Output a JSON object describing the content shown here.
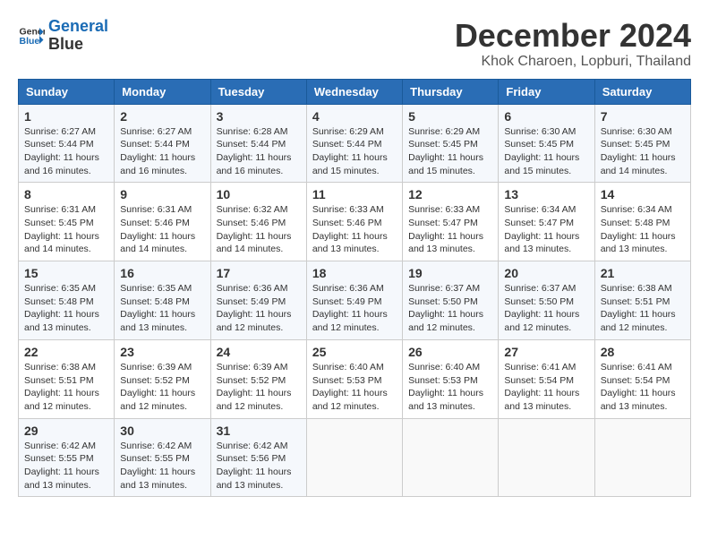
{
  "logo": {
    "line1": "General",
    "line2": "Blue"
  },
  "title": "December 2024",
  "location": "Khok Charoen, Lopburi, Thailand",
  "weekdays": [
    "Sunday",
    "Monday",
    "Tuesday",
    "Wednesday",
    "Thursday",
    "Friday",
    "Saturday"
  ],
  "weeks": [
    [
      {
        "day": 1,
        "sunrise": "6:27 AM",
        "sunset": "5:44 PM",
        "daylight": "11 hours and 16 minutes."
      },
      {
        "day": 2,
        "sunrise": "6:27 AM",
        "sunset": "5:44 PM",
        "daylight": "11 hours and 16 minutes."
      },
      {
        "day": 3,
        "sunrise": "6:28 AM",
        "sunset": "5:44 PM",
        "daylight": "11 hours and 16 minutes."
      },
      {
        "day": 4,
        "sunrise": "6:29 AM",
        "sunset": "5:44 PM",
        "daylight": "11 hours and 15 minutes."
      },
      {
        "day": 5,
        "sunrise": "6:29 AM",
        "sunset": "5:45 PM",
        "daylight": "11 hours and 15 minutes."
      },
      {
        "day": 6,
        "sunrise": "6:30 AM",
        "sunset": "5:45 PM",
        "daylight": "11 hours and 15 minutes."
      },
      {
        "day": 7,
        "sunrise": "6:30 AM",
        "sunset": "5:45 PM",
        "daylight": "11 hours and 14 minutes."
      }
    ],
    [
      {
        "day": 8,
        "sunrise": "6:31 AM",
        "sunset": "5:45 PM",
        "daylight": "11 hours and 14 minutes."
      },
      {
        "day": 9,
        "sunrise": "6:31 AM",
        "sunset": "5:46 PM",
        "daylight": "11 hours and 14 minutes."
      },
      {
        "day": 10,
        "sunrise": "6:32 AM",
        "sunset": "5:46 PM",
        "daylight": "11 hours and 14 minutes."
      },
      {
        "day": 11,
        "sunrise": "6:33 AM",
        "sunset": "5:46 PM",
        "daylight": "11 hours and 13 minutes."
      },
      {
        "day": 12,
        "sunrise": "6:33 AM",
        "sunset": "5:47 PM",
        "daylight": "11 hours and 13 minutes."
      },
      {
        "day": 13,
        "sunrise": "6:34 AM",
        "sunset": "5:47 PM",
        "daylight": "11 hours and 13 minutes."
      },
      {
        "day": 14,
        "sunrise": "6:34 AM",
        "sunset": "5:48 PM",
        "daylight": "11 hours and 13 minutes."
      }
    ],
    [
      {
        "day": 15,
        "sunrise": "6:35 AM",
        "sunset": "5:48 PM",
        "daylight": "11 hours and 13 minutes."
      },
      {
        "day": 16,
        "sunrise": "6:35 AM",
        "sunset": "5:48 PM",
        "daylight": "11 hours and 13 minutes."
      },
      {
        "day": 17,
        "sunrise": "6:36 AM",
        "sunset": "5:49 PM",
        "daylight": "11 hours and 12 minutes."
      },
      {
        "day": 18,
        "sunrise": "6:36 AM",
        "sunset": "5:49 PM",
        "daylight": "11 hours and 12 minutes."
      },
      {
        "day": 19,
        "sunrise": "6:37 AM",
        "sunset": "5:50 PM",
        "daylight": "11 hours and 12 minutes."
      },
      {
        "day": 20,
        "sunrise": "6:37 AM",
        "sunset": "5:50 PM",
        "daylight": "11 hours and 12 minutes."
      },
      {
        "day": 21,
        "sunrise": "6:38 AM",
        "sunset": "5:51 PM",
        "daylight": "11 hours and 12 minutes."
      }
    ],
    [
      {
        "day": 22,
        "sunrise": "6:38 AM",
        "sunset": "5:51 PM",
        "daylight": "11 hours and 12 minutes."
      },
      {
        "day": 23,
        "sunrise": "6:39 AM",
        "sunset": "5:52 PM",
        "daylight": "11 hours and 12 minutes."
      },
      {
        "day": 24,
        "sunrise": "6:39 AM",
        "sunset": "5:52 PM",
        "daylight": "11 hours and 12 minutes."
      },
      {
        "day": 25,
        "sunrise": "6:40 AM",
        "sunset": "5:53 PM",
        "daylight": "11 hours and 12 minutes."
      },
      {
        "day": 26,
        "sunrise": "6:40 AM",
        "sunset": "5:53 PM",
        "daylight": "11 hours and 13 minutes."
      },
      {
        "day": 27,
        "sunrise": "6:41 AM",
        "sunset": "5:54 PM",
        "daylight": "11 hours and 13 minutes."
      },
      {
        "day": 28,
        "sunrise": "6:41 AM",
        "sunset": "5:54 PM",
        "daylight": "11 hours and 13 minutes."
      }
    ],
    [
      {
        "day": 29,
        "sunrise": "6:42 AM",
        "sunset": "5:55 PM",
        "daylight": "11 hours and 13 minutes."
      },
      {
        "day": 30,
        "sunrise": "6:42 AM",
        "sunset": "5:55 PM",
        "daylight": "11 hours and 13 minutes."
      },
      {
        "day": 31,
        "sunrise": "6:42 AM",
        "sunset": "5:56 PM",
        "daylight": "11 hours and 13 minutes."
      },
      null,
      null,
      null,
      null
    ]
  ]
}
